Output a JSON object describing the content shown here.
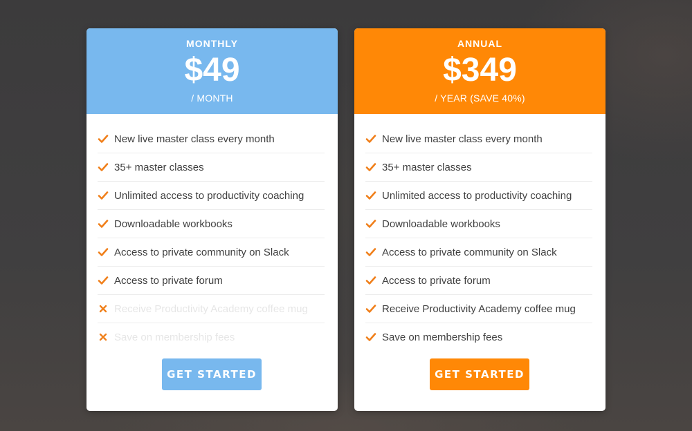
{
  "colors": {
    "monthly_accent": "#78b8ee",
    "annual_accent": "#ff8806",
    "check_icon": "#f07f1a",
    "background": "#3f3e3f"
  },
  "plans": [
    {
      "name": "MONTHLY",
      "price": "$49",
      "period": "/ MONTH",
      "cta_label": "GET STARTED",
      "features": [
        {
          "label": "New live master class every month",
          "included": true,
          "icon": "check-icon"
        },
        {
          "label": "35+ master classes",
          "included": true,
          "icon": "check-icon"
        },
        {
          "label": "Unlimited access to productivity coaching",
          "included": true,
          "icon": "check-icon"
        },
        {
          "label": "Downloadable workbooks",
          "included": true,
          "icon": "check-icon"
        },
        {
          "label": "Access to private community on Slack",
          "included": true,
          "icon": "check-icon"
        },
        {
          "label": "Access to private forum",
          "included": true,
          "icon": "check-icon"
        },
        {
          "label": "Receive Productivity Academy coffee mug",
          "included": false,
          "icon": "cross-icon"
        },
        {
          "label": "Save on membership fees",
          "included": false,
          "icon": "cross-icon"
        }
      ]
    },
    {
      "name": "ANNUAL",
      "price": "$349",
      "period": "/ YEAR (SAVE 40%)",
      "cta_label": "GET STARTED",
      "features": [
        {
          "label": "New live master class every month",
          "included": true,
          "icon": "check-icon"
        },
        {
          "label": "35+ master classes",
          "included": true,
          "icon": "check-icon"
        },
        {
          "label": "Unlimited access to productivity coaching",
          "included": true,
          "icon": "check-icon"
        },
        {
          "label": "Downloadable workbooks",
          "included": true,
          "icon": "check-icon"
        },
        {
          "label": "Access to private community on Slack",
          "included": true,
          "icon": "check-icon"
        },
        {
          "label": "Access to private forum",
          "included": true,
          "icon": "check-icon"
        },
        {
          "label": "Receive Productivity Academy coffee mug",
          "included": true,
          "icon": "check-icon"
        },
        {
          "label": "Save on membership fees",
          "included": true,
          "icon": "check-icon"
        }
      ]
    }
  ]
}
